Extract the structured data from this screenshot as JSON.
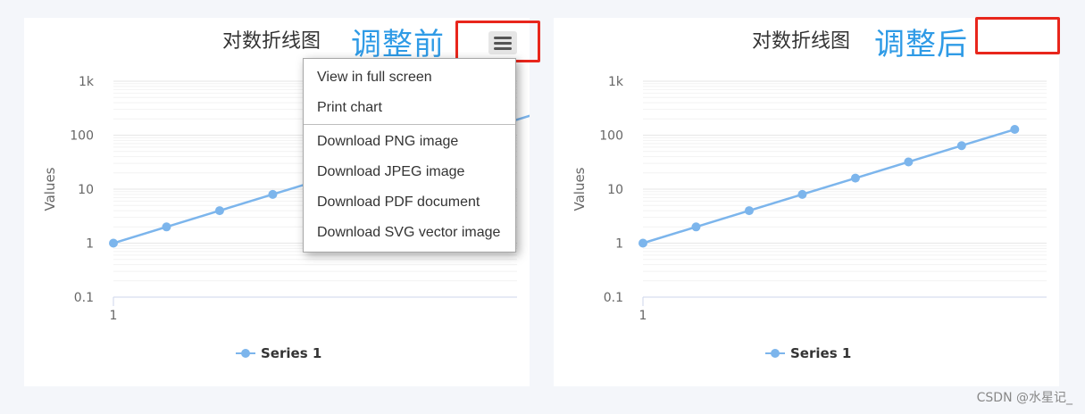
{
  "panels": {
    "left": {
      "title": "对数折线图",
      "annotation": "调整前",
      "menu": {
        "items": [
          "View in full screen",
          "Print chart",
          "Download PNG image",
          "Download JPEG image",
          "Download PDF document",
          "Download SVG vector image"
        ]
      }
    },
    "right": {
      "title": "对数折线图",
      "annotation": "调整后"
    }
  },
  "colors": {
    "series": "#7cb5ec",
    "annotation": "#2f9be6",
    "highlight_box": "#e8261c",
    "gridline": "#e6e6e6"
  },
  "icons": {
    "menu": "hamburger-icon"
  },
  "watermark": "CSDN @水星记_",
  "chart_data": [
    {
      "type": "line",
      "title": "对数折线图",
      "ylabel": "Values",
      "y_scale": "log",
      "ylim": [
        0.1,
        1000
      ],
      "yticks": [
        "0.1",
        "1",
        "10",
        "100",
        "1k"
      ],
      "xticks": [
        "1"
      ],
      "grid": true,
      "legend_position": "bottom-center",
      "series": [
        {
          "name": "Series 1",
          "x": [
            1,
            2,
            3,
            4,
            5,
            6,
            7,
            8,
            9
          ],
          "values": [
            1,
            2,
            4,
            8,
            16,
            32,
            64,
            128,
            256
          ]
        }
      ]
    },
    {
      "type": "line",
      "title": "对数折线图",
      "ylabel": "Values",
      "y_scale": "log",
      "ylim": [
        0.1,
        1000
      ],
      "yticks": [
        "0.1",
        "1",
        "10",
        "100",
        "1k"
      ],
      "xticks": [
        "1"
      ],
      "grid": true,
      "legend_position": "bottom-center",
      "series": [
        {
          "name": "Series 1",
          "x": [
            1,
            2,
            3,
            4,
            5,
            6,
            7,
            8
          ],
          "values": [
            1,
            2,
            4,
            8,
            16,
            32,
            64,
            128
          ]
        }
      ]
    }
  ]
}
